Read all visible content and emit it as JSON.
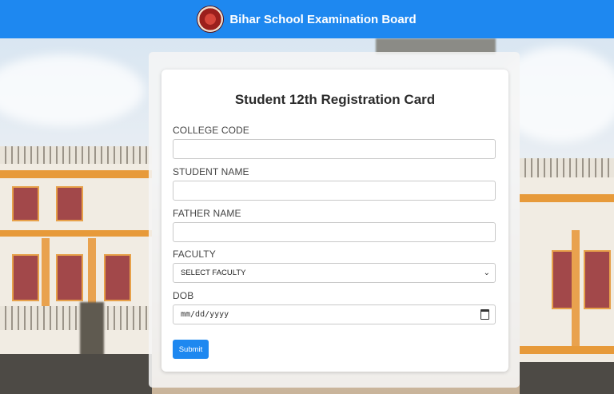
{
  "header": {
    "title": "Bihar School Examination Board",
    "logo_icon": "bseb-emblem",
    "background_color": "#1e88f0"
  },
  "form": {
    "title": "Student 12th Registration Card",
    "fields": {
      "college_code": {
        "label": "COLLEGE CODE",
        "value": ""
      },
      "student_name": {
        "label": "STUDENT NAME",
        "value": ""
      },
      "father_name": {
        "label": "FATHER NAME",
        "value": ""
      },
      "faculty": {
        "label": "FACULTY",
        "selected": "SELECT FACULTY"
      },
      "dob": {
        "label": "DOB",
        "placeholder": "mm/dd/yyyy"
      }
    },
    "submit_label": "Submit",
    "accent_color": "#1e88f0"
  }
}
